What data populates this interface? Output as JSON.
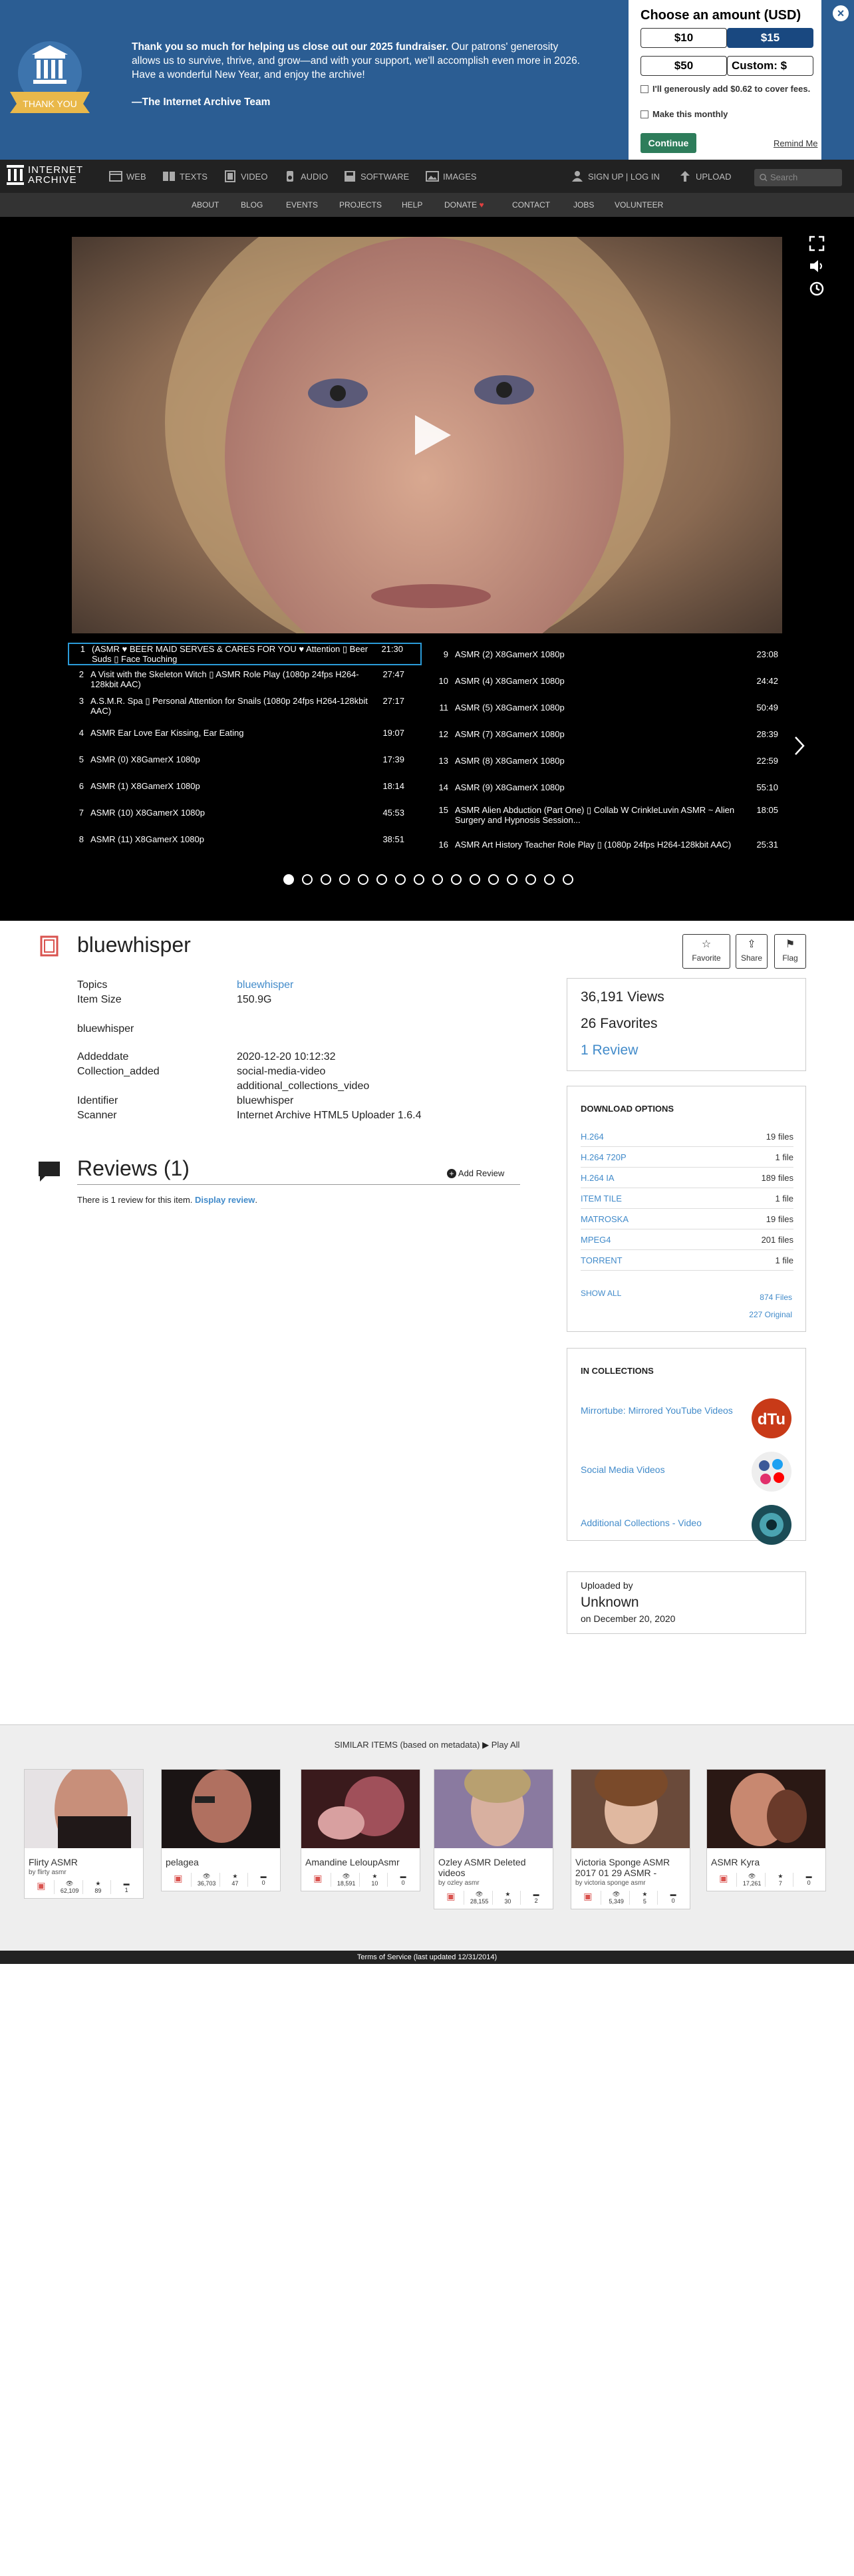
{
  "donate": {
    "thank_you_badge": "THANK YOU",
    "message_bold": "Thank you so much for helping us close out our 2025 fundraiser.",
    "message_rest": " Our patrons' generosity allows us to survive, thrive, and grow—and with your support, we'll accomplish even more in 2026. Have a wonderful New Year, and enjoy the archive!",
    "signature": "—The Internet Archive Team",
    "box_title": "Choose an amount (USD)",
    "amounts": [
      "$10",
      "$15",
      "$50",
      "Custom: $"
    ],
    "selected_amount": "$15",
    "cover_fees": "I'll generously add $0.62 to cover fees.",
    "monthly": "Make this monthly",
    "continue": "Continue",
    "remind": "Remind Me"
  },
  "nav": {
    "logo_line1": "INTERNET",
    "logo_line2": "ARCHIVE",
    "items": [
      "WEB",
      "TEXTS",
      "VIDEO",
      "AUDIO",
      "SOFTWARE",
      "IMAGES"
    ],
    "signup": "SIGN UP | LOG IN",
    "upload": "UPLOAD",
    "search_placeholder": "Search"
  },
  "subnav": [
    "ABOUT",
    "BLOG",
    "EVENTS",
    "PROJECTS",
    "HELP",
    "DONATE",
    "CONTACT",
    "JOBS",
    "VOLUNTEER"
  ],
  "playlist_left": [
    {
      "n": "1",
      "t": "(ASMR ♥ BEER MAID SERVES & CARES FOR YOU ♥ Attention ▯ Beer Suds ▯ Face Touching",
      "d": "21:30"
    },
    {
      "n": "2",
      "t": "A Visit with the Skeleton Witch ▯ ASMR Role Play (1080p 24fps H264-128kbit AAC)",
      "d": "27:47"
    },
    {
      "n": "3",
      "t": "A.S.M.R. Spa ▯ Personal Attention for Snails (1080p 24fps H264-128kbit AAC)",
      "d": "27:17"
    },
    {
      "n": "4",
      "t": "ASMR Ear Love Ear Kissing, Ear Eating",
      "d": "19:07"
    },
    {
      "n": "5",
      "t": "ASMR (0) X8GamerX 1080p",
      "d": "17:39"
    },
    {
      "n": "6",
      "t": "ASMR (1) X8GamerX 1080p",
      "d": "18:14"
    },
    {
      "n": "7",
      "t": "ASMR (10) X8GamerX 1080p",
      "d": "45:53"
    },
    {
      "n": "8",
      "t": "ASMR (11) X8GamerX 1080p",
      "d": "38:51"
    }
  ],
  "playlist_right": [
    {
      "n": "9",
      "t": "ASMR (2) X8GamerX 1080p",
      "d": "23:08"
    },
    {
      "n": "10",
      "t": "ASMR (4) X8GamerX 1080p",
      "d": "24:42"
    },
    {
      "n": "11",
      "t": "ASMR (5) X8GamerX 1080p",
      "d": "50:49"
    },
    {
      "n": "12",
      "t": "ASMR (7) X8GamerX 1080p",
      "d": "28:39"
    },
    {
      "n": "13",
      "t": "ASMR (8) X8GamerX 1080p",
      "d": "22:59"
    },
    {
      "n": "14",
      "t": "ASMR (9) X8GamerX 1080p",
      "d": "55:10"
    },
    {
      "n": "15",
      "t": "ASMR Alien Abduction (Part One) ▯ Collab W CrinkleLuvin ASMR ~ Alien Surgery and Hypnosis Session...",
      "d": "18:05"
    },
    {
      "n": "16",
      "t": "ASMR Art History Teacher Role Play ▯ (1080p 24fps H264-128kbit AAC)",
      "d": "25:31"
    }
  ],
  "item": {
    "title": "bluewhisper",
    "actions": [
      "Favorite",
      "Share",
      "Flag"
    ],
    "topics_label": "Topics",
    "topics": "bluewhisper",
    "size_label": "Item Size",
    "size": "150.9G",
    "description": "bluewhisper",
    "addeddate_label": "Addeddate",
    "addeddate": "2020-12-20 10:12:32",
    "collection_label": "Collection_added",
    "collection1": "social-media-video",
    "collection2": "additional_collections_video",
    "identifier_label": "Identifier",
    "identifier": "bluewhisper",
    "scanner_label": "Scanner",
    "scanner": "Internet Archive HTML5 Uploader 1.6.4"
  },
  "reviews": {
    "heading": "Reviews (1)",
    "add": "Add Review",
    "text": "There is 1 review for this item.",
    "link": "Display review"
  },
  "stats": {
    "views": "36,191 Views",
    "favorites": "26 Favorites",
    "reviews": "1 Review"
  },
  "downloads": {
    "heading": "DOWNLOAD OPTIONS",
    "rows": [
      {
        "l": "H.264",
        "r": "19 files"
      },
      {
        "l": "H.264 720P",
        "r": "1 file"
      },
      {
        "l": "H.264 IA",
        "r": "189 files"
      },
      {
        "l": "ITEM TILE",
        "r": "1 file"
      },
      {
        "l": "MATROSKA",
        "r": "19 files"
      },
      {
        "l": "MPEG4",
        "r": "201 files"
      },
      {
        "l": "TORRENT",
        "r": "1 file"
      }
    ],
    "show_all": "SHOW ALL",
    "files": "874 Files",
    "original": "227 Original"
  },
  "collections": {
    "heading": "IN COLLECTIONS",
    "items": [
      "Mirrortube: Mirrored YouTube Videos",
      "Social Media Videos",
      "Additional Collections - Video"
    ]
  },
  "uploader": {
    "label": "Uploaded by",
    "name": "Unknown",
    "date": "on December 20, 2020"
  },
  "similar": {
    "heading": "SIMILAR ITEMS (based on metadata)",
    "play_all": "Play All",
    "cards": [
      {
        "title": "Flirty ASMR",
        "by": "by flirty asmr",
        "views": "62,109",
        "favs": "89",
        "reviews": "1"
      },
      {
        "title": "pelagea",
        "by": "",
        "views": "36,703",
        "favs": "47",
        "reviews": "0"
      },
      {
        "title": "Amandine LeloupAsmr",
        "by": "",
        "views": "18,591",
        "favs": "10",
        "reviews": "0"
      },
      {
        "title": "Ozley ASMR Deleted videos",
        "by": "by ozley asmr",
        "views": "28,155",
        "favs": "30",
        "reviews": "2"
      },
      {
        "title": "Victoria Sponge ASMR 2017 01 29 ASMR -",
        "by": "by victoria sponge asmr",
        "views": "5,349",
        "favs": "5",
        "reviews": "0"
      },
      {
        "title": "ASMR Kyra",
        "by": "",
        "views": "17,261",
        "favs": "7",
        "reviews": "0"
      }
    ]
  },
  "footer": "Terms of Service (last updated 12/31/2014)",
  "colors": {
    "brand_blue": "#2b5d93",
    "selected_blue": "#194880",
    "continue_green": "#2e7d5b",
    "link": "#428bca"
  }
}
